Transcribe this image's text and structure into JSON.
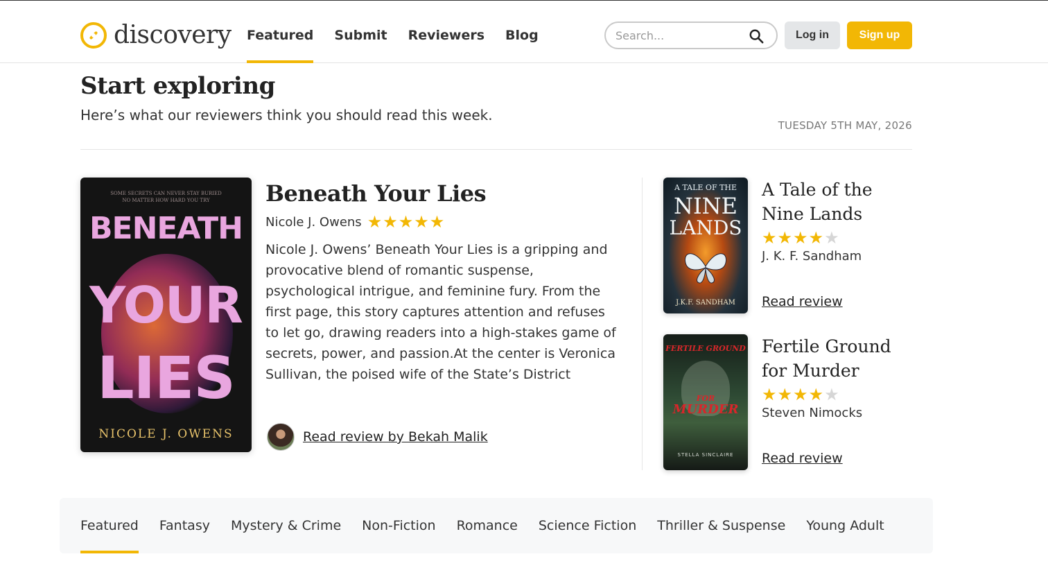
{
  "header": {
    "logo_text": "discovery",
    "nav": [
      {
        "label": "Featured",
        "active": true
      },
      {
        "label": "Submit"
      },
      {
        "label": "Reviewers"
      },
      {
        "label": "Blog"
      }
    ],
    "search_placeholder": "Search...",
    "login_label": "Log in",
    "signup_label": "Sign up"
  },
  "hero": {
    "title": "Start exploring",
    "subtitle": "Here’s what our reviewers think you should read this week.",
    "date": "TUESDAY 5TH MAY, 2026"
  },
  "featured": {
    "cover": {
      "tagline_1": "SOME SECRETS CAN NEVER STAY BURIED",
      "tagline_2": "NO MATTER HOW HARD YOU TRY",
      "word_1": "BENEATH",
      "word_2": "YOUR",
      "word_3": "LIES",
      "author": "NICOLE J. OWENS"
    },
    "title": "Beneath Your Lies",
    "author": "Nicole J. Owens",
    "rating": 5,
    "description": "Nicole J. Owens’ Beneath Your Lies is a gripping and provocative blend of romantic suspense, psychological intrigue, and feminine fury. From the first page, this story captures attention and refuses to let go, drawing readers into a high-stakes game of secrets, power, and passion.At the center is Veronica Sullivan, the poised wife of the State’s District Attorney, whose polished…",
    "review_link": "Read review by Bekah Malik"
  },
  "side_books": [
    {
      "title": "A Tale of the Nine Lands",
      "author": "J. K. F. Sandham",
      "rating": 4,
      "link": "Read review",
      "cover": {
        "line_1": "A TALE OF THE",
        "line_2": "NINE",
        "line_3": "LANDS",
        "author": "J.K.F. SANDHAM"
      }
    },
    {
      "title": "Fertile Ground for Murder",
      "author": "Steven Nimocks",
      "rating": 4,
      "link": "Read review",
      "cover": {
        "line_1": "FERTILE GROUND",
        "line_2": "FOR",
        "line_3": "MURDER",
        "author": "STELLA SINCLAIRE"
      }
    }
  ],
  "categories": [
    {
      "label": "Featured",
      "active": true
    },
    {
      "label": "Fantasy"
    },
    {
      "label": "Mystery & Crime"
    },
    {
      "label": "Non-Fiction"
    },
    {
      "label": "Romance"
    },
    {
      "label": "Science Fiction"
    },
    {
      "label": "Thriller & Suspense"
    },
    {
      "label": "Young Adult"
    }
  ],
  "colors": {
    "accent": "#f2b705",
    "star_off": "#d6d6d6",
    "login_bg": "#e4e6e8"
  },
  "icons": {
    "logo": "compass-icon",
    "search": "search-icon",
    "star": "star-icon"
  }
}
